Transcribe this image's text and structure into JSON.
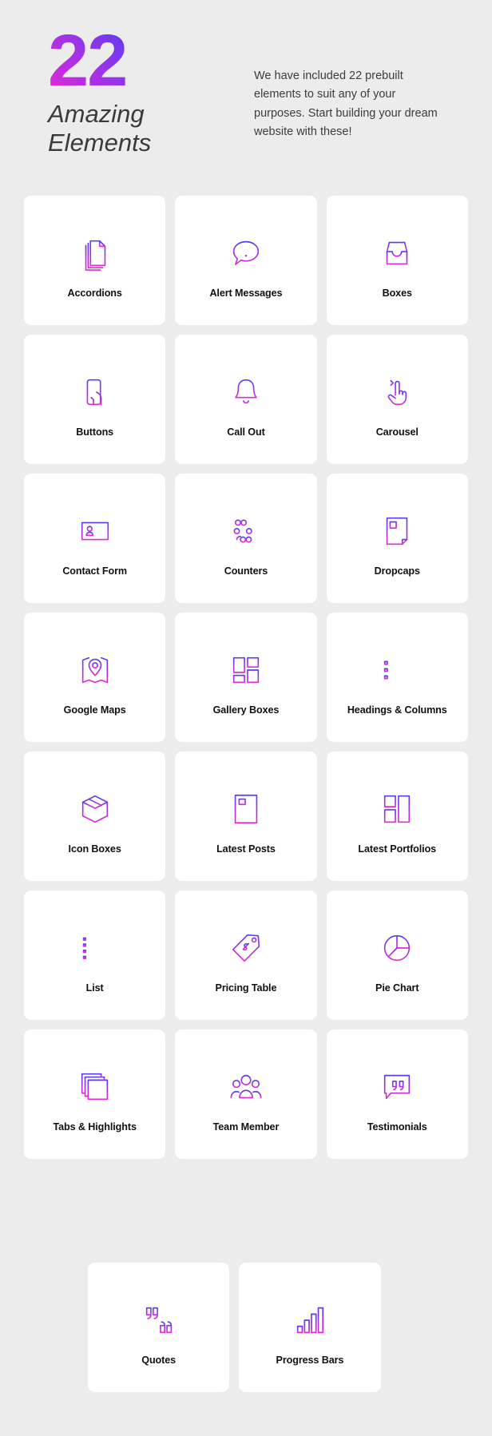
{
  "header": {
    "number": "22",
    "subtitle_line1": "Amazing",
    "subtitle_line2": "Elements",
    "description": "We have included 22 prebuilt elements to suit any of your purposes. Start building your dream website with these!",
    "gradient_start": "#e22ad0",
    "gradient_end": "#5b3bf5"
  },
  "theme": {
    "background": "#ececec",
    "card_background": "#ffffff",
    "label_color": "#111111",
    "icon_gradient_top": "#5b3bf5",
    "icon_gradient_bottom": "#e22ad0"
  },
  "elements": [
    {
      "label": "Accordions",
      "icon": "stacked-pages-icon"
    },
    {
      "label": "Alert Messages",
      "icon": "speech-bubble-exclamation-icon"
    },
    {
      "label": "Boxes",
      "icon": "open-box-tray-icon"
    },
    {
      "label": "Buttons",
      "icon": "phone-tap-icon"
    },
    {
      "label": "Call Out",
      "icon": "bell-icon"
    },
    {
      "label": "Carousel",
      "icon": "hand-swipe-arrow-icon"
    },
    {
      "label": "Contact Form",
      "icon": "contact-card-icon"
    },
    {
      "label": "Counters",
      "icon": "sliders-icon"
    },
    {
      "label": "Dropcaps",
      "icon": "document-dropcap-icon"
    },
    {
      "label": "Google Maps",
      "icon": "map-pin-icon"
    },
    {
      "label": "Gallery Boxes",
      "icon": "gallery-grid-icon"
    },
    {
      "label": "Headings & Columns",
      "icon": "heading-lines-icon"
    },
    {
      "label": "Icon Boxes",
      "icon": "cube-box-icon"
    },
    {
      "label": "Latest Posts",
      "icon": "article-document-icon"
    },
    {
      "label": "Latest Portfolios",
      "icon": "portfolio-grid-icon"
    },
    {
      "label": "List",
      "icon": "bullet-list-icon"
    },
    {
      "label": "Pricing Table",
      "icon": "price-tag-icon"
    },
    {
      "label": "Pie Chart",
      "icon": "pie-chart-icon"
    },
    {
      "label": "Tabs & Highlights",
      "icon": "layered-tabs-icon"
    },
    {
      "label": "Team Member",
      "icon": "people-group-icon"
    },
    {
      "label": "Testimonials",
      "icon": "quote-bubble-icon"
    },
    {
      "label": "Quotes",
      "icon": "quotation-marks-icon"
    },
    {
      "label": "Progress Bars",
      "icon": "bar-levels-icon"
    }
  ]
}
